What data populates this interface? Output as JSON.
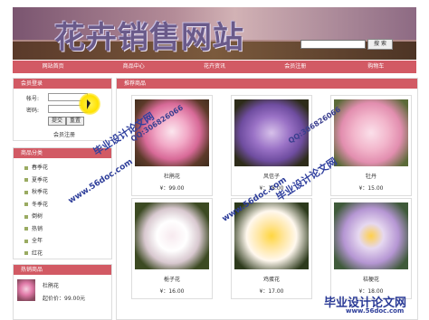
{
  "site": {
    "title": "花卉销售网站"
  },
  "search": {
    "button": "搜 索"
  },
  "nav": [
    "网站首页",
    "商品中心",
    "花卉资讯",
    "会员注册",
    "购物车"
  ],
  "login": {
    "header": "会员登录",
    "account_label": "帐号:",
    "password_label": "密码:",
    "submit": "提交",
    "reset": "重置",
    "register": "会员注册"
  },
  "categories": {
    "header": "商品分类",
    "items": [
      "春季花",
      "夏季花",
      "秋季花",
      "冬季花",
      "倒树",
      "热销",
      "全年",
      "红花"
    ]
  },
  "hot": {
    "header": "热销商品",
    "name": "杜鹃花",
    "price": "起价价：99.00元"
  },
  "recommended": {
    "header": "推荐商品",
    "products": [
      {
        "name": "杜鹃花",
        "price": "¥：99.00"
      },
      {
        "name": "风信子",
        "price": "¥：18.00"
      },
      {
        "name": "牡丹",
        "price": "¥：15.00"
      },
      {
        "name": "栀子花",
        "price": "¥：16.00"
      },
      {
        "name": "鸡蛋花",
        "price": "¥：17.00"
      },
      {
        "name": "桔梗花",
        "price": "¥：18.00"
      }
    ]
  },
  "watermarks": {
    "url": "www.56doc.com",
    "qq": "QQ:306826066",
    "cn": "毕业设计论文网",
    "corner_cn": "毕业设计论文网",
    "corner_url": "www.56doc.com"
  },
  "colors": {
    "accent": "#d25a64",
    "watermark": "#2c3c99"
  }
}
